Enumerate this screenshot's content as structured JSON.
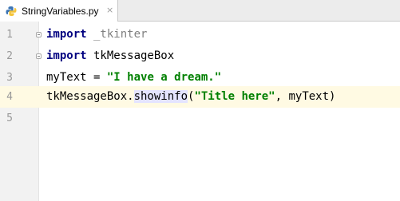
{
  "tab": {
    "filename": "StringVariables.py",
    "close_glyph": "×",
    "icon": "python-file-icon"
  },
  "colors": {
    "keyword": "#000080",
    "string": "#008000",
    "unused": "#808080",
    "current_line": "#fffae3"
  },
  "lines": [
    {
      "number": "1",
      "keyword": "import",
      "rest": " _tkinter"
    },
    {
      "number": "2",
      "keyword": "import",
      "rest": " tkMessageBox"
    },
    {
      "number": "3",
      "var": "myText",
      "op": " = ",
      "string": "\"I have a dream.\""
    },
    {
      "number": "4",
      "obj": "tkMessageBox.",
      "method": "showinfo",
      "open": "(",
      "string": "\"Title here\"",
      "args": ", myText)"
    },
    {
      "number": "5"
    }
  ]
}
